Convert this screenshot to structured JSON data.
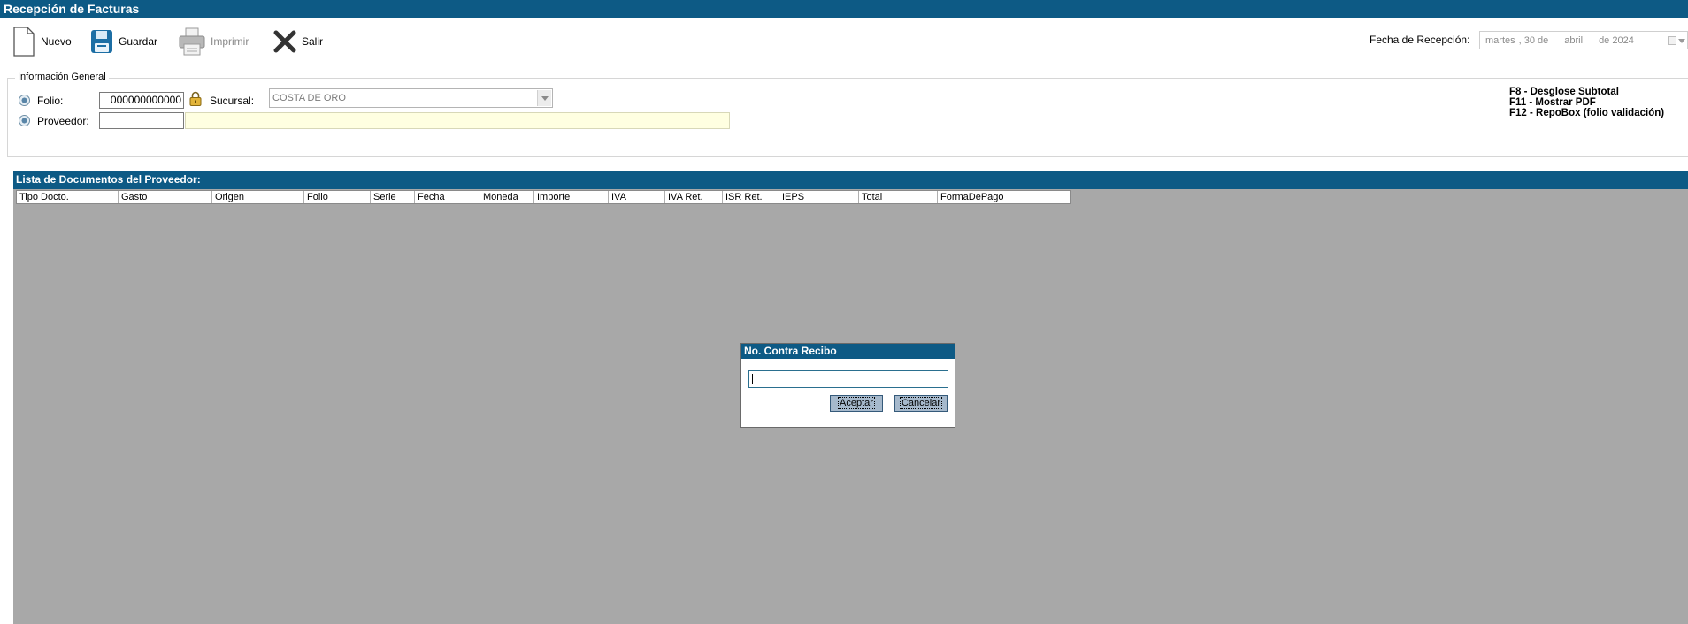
{
  "window": {
    "title": "Recepción de Facturas"
  },
  "toolbar": {
    "nuevo": "Nuevo",
    "guardar": "Guardar",
    "imprimir": "Imprimir",
    "salir": "Salir",
    "fecha_label": "Fecha de Recepción:",
    "fecha_weekday": "martes",
    "fecha_day": ", 30 de",
    "fecha_month": "abril",
    "fecha_year": "de 2024"
  },
  "info": {
    "legend": "Información General",
    "folio_label": "Folio:",
    "folio_value": "000000000000",
    "sucursal_label": "Sucursal:",
    "sucursal_value": "COSTA DE ORO",
    "proveedor_label": "Proveedor:",
    "proveedor_value": "",
    "proveedor_name": ""
  },
  "shortcuts": [
    "F8  - Desglose Subtotal",
    "F11 - Mostrar PDF",
    "F12 - RepoBox (folio validación)"
  ],
  "documents": {
    "header": "Lista de Documentos del Proveedor:",
    "columns": [
      "Tipo Docto.",
      "Gasto",
      "Origen",
      "Folio",
      "Serie",
      "Fecha",
      "Moneda",
      "Importe",
      "IVA",
      "IVA Ret.",
      "ISR Ret.",
      "IEPS",
      "Total",
      "FormaDePago"
    ]
  },
  "modal": {
    "title": "No. Contra Recibo",
    "input_value": "",
    "accept": "Aceptar",
    "cancel": "Cancelar"
  }
}
